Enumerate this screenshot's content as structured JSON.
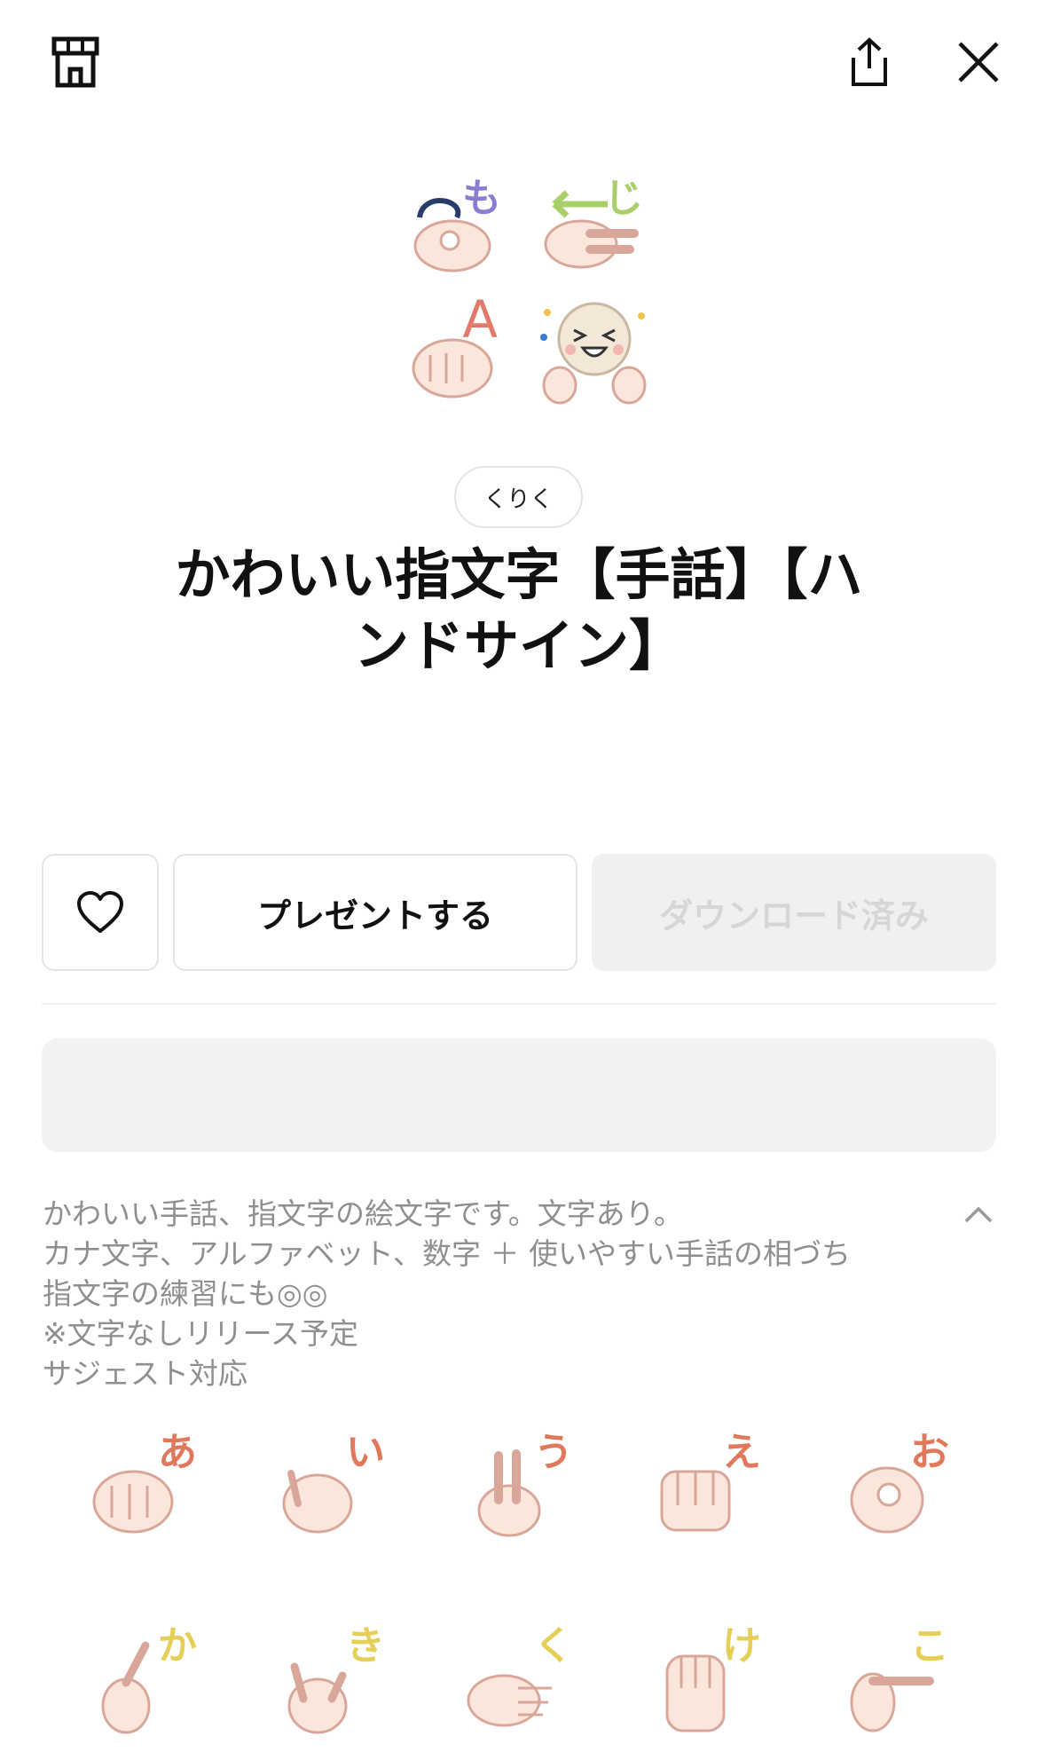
{
  "header": {
    "shop_icon": "shop-icon",
    "share_icon": "share-icon",
    "close_icon": "close-icon"
  },
  "hero": {
    "cells": [
      {
        "label": "も",
        "color": "#8a7cd0"
      },
      {
        "label": "じ",
        "color": "#a9cf6a"
      },
      {
        "label": "A",
        "color": "#e07a6a"
      },
      {
        "label": "",
        "color": "#f3e7d8"
      }
    ]
  },
  "author": "くりく",
  "title_line1": "かわいい指文字【手話】【ハ",
  "title_line2": "ンドサイン】",
  "actions": {
    "favorite_icon": "heart-icon",
    "present_label": "プレゼントする",
    "downloaded_label": "ダウンロード済み"
  },
  "description": {
    "lines": [
      "かわいい手話、指文字の絵文字です。文字あり。",
      "カナ文字、アルファベット、数字 ＋ 使いやすい手話の相づち",
      "指文字の練習にも◎◎",
      "※文字なしリリース予定",
      "サジェスト対応"
    ],
    "collapse_icon": "chevron-up-icon"
  },
  "emojis": [
    {
      "label": "あ",
      "color": "#e0785c"
    },
    {
      "label": "い",
      "color": "#e0785c"
    },
    {
      "label": "う",
      "color": "#e0785c"
    },
    {
      "label": "え",
      "color": "#e0785c"
    },
    {
      "label": "お",
      "color": "#e0785c"
    },
    {
      "label": "か",
      "color": "#e6cf57"
    },
    {
      "label": "き",
      "color": "#e6cf57"
    },
    {
      "label": "く",
      "color": "#e6cf57"
    },
    {
      "label": "け",
      "color": "#e6cf57"
    },
    {
      "label": "こ",
      "color": "#e6cf57"
    }
  ]
}
